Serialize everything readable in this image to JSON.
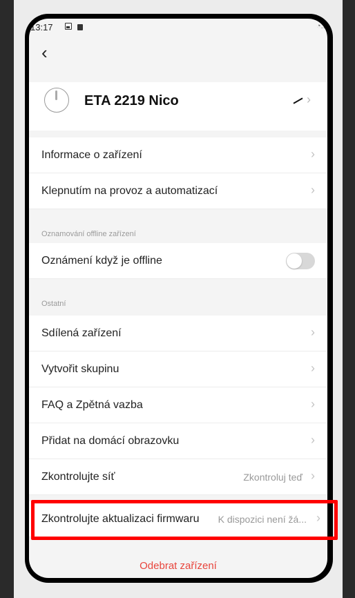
{
  "status_bar": {
    "time": "13:17"
  },
  "device": {
    "name": "ETA 2219 Nico"
  },
  "section1": {
    "items": [
      {
        "label": "Informace o zařízení"
      },
      {
        "label": "Klepnutím na provoz a automatizací"
      }
    ]
  },
  "section_offline": {
    "title": "Oznamování offline zařízení",
    "item_label": "Oznámení když je offline",
    "toggle_on": false
  },
  "section_other": {
    "title": "Ostatní",
    "items": [
      {
        "label": "Sdílená zařízení"
      },
      {
        "label": "Vytvořit skupinu"
      },
      {
        "label": "FAQ a Zpětná vazba"
      },
      {
        "label": "Přidat na domácí obrazovku"
      },
      {
        "label": "Zkontrolujte síť",
        "value": "Zkontroluj teď"
      },
      {
        "label": "Zkontrolujte aktualizaci firmwaru",
        "value": "K dispozici není žá..."
      }
    ]
  },
  "remove_label": "Odebrat zařízení",
  "colors": {
    "highlight": "#ff0000",
    "danger": "#e8453c",
    "toggle_off": "#d8d8d8"
  }
}
